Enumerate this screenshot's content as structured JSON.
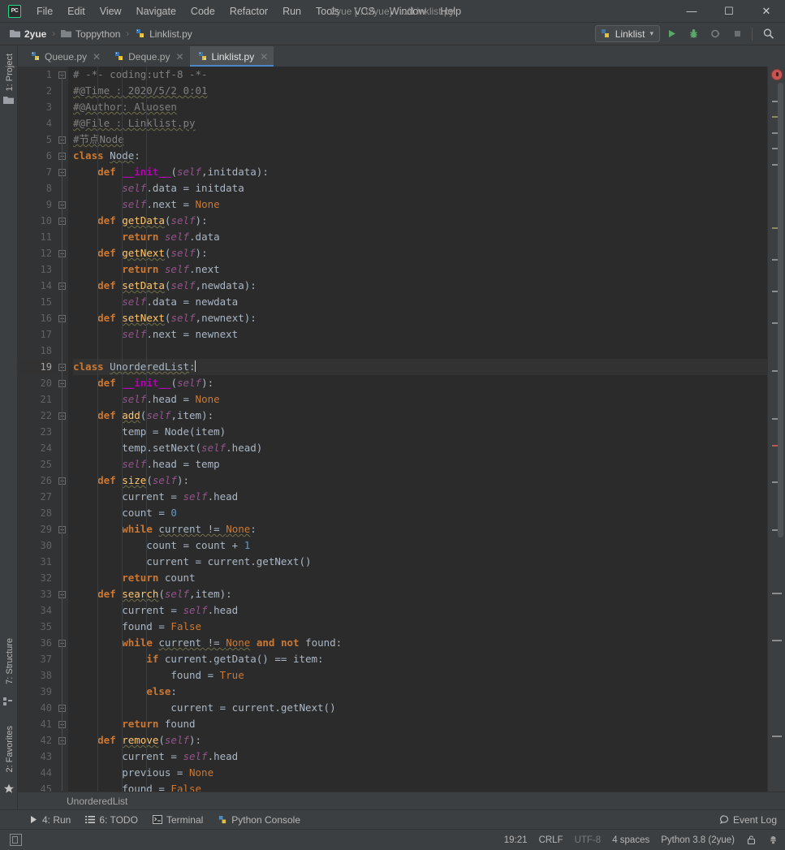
{
  "window": {
    "title": "2yue [...\\2yue] - ...\\Linklist.py",
    "logo_label": "PC",
    "controls": {
      "minimize": "—",
      "maximize": "☐",
      "close": "✕"
    }
  },
  "menu": {
    "items": [
      "File",
      "Edit",
      "View",
      "Navigate",
      "Code",
      "Refactor",
      "Run",
      "Tools",
      "VCS",
      "Window",
      "Help"
    ]
  },
  "breadcrumb": {
    "items": [
      {
        "label": "2yue",
        "icon": "folder-icon"
      },
      {
        "label": "Toppython",
        "icon": "folder-icon"
      },
      {
        "label": "Linklist.py",
        "icon": "python-file-icon"
      }
    ],
    "separator": "›"
  },
  "toolbar": {
    "run_config": "Linklist",
    "run_config_caret": "▾",
    "buttons": [
      {
        "name": "run-button",
        "icon": "play-icon"
      },
      {
        "name": "debug-button",
        "icon": "bug-icon"
      },
      {
        "name": "run-coverage-button",
        "icon": "coverage-icon"
      },
      {
        "name": "stop-button",
        "icon": "stop-icon"
      },
      {
        "name": "search-everywhere-button",
        "icon": "search-icon"
      }
    ]
  },
  "left_rail": {
    "project": "1: Project",
    "structure": "7: Structure",
    "favorites": "2: Favorites"
  },
  "editor_tabs": [
    {
      "label": "Queue.py",
      "icon": "python-file-icon",
      "active": false,
      "close": "✕"
    },
    {
      "label": "Deque.py",
      "icon": "python-file-icon",
      "active": false,
      "close": "✕"
    },
    {
      "label": "Linklist.py",
      "icon": "python-file-icon",
      "active": true,
      "close": "✕"
    }
  ],
  "editor": {
    "current_line": 19,
    "first_line": 1,
    "last_line": 45,
    "line_count": 45,
    "breadcrumb": "UnorderedList",
    "error_count_icon": "error-badge-icon",
    "lines": [
      {
        "n": 1,
        "fold": "minus",
        "html": "<span class=\"c-comment\">#</span> <span class=\"c-comment\">-*- coding:utf-8 -*-</span>"
      },
      {
        "n": 2,
        "fold": "",
        "html": "<span class=\"c-comment sq\">#@Time : 2020/5/2 0:01</span>"
      },
      {
        "n": 3,
        "fold": "",
        "html": "<span class=\"c-comment sq\">#@Author: Aluosen</span>"
      },
      {
        "n": 4,
        "fold": "",
        "html": "<span class=\"c-comment sq\">#@File : Linklist.py</span>"
      },
      {
        "n": 5,
        "fold": "minus",
        "html": "<span class=\"c-comment sq\">#节点Node</span>"
      },
      {
        "n": 6,
        "fold": "minus",
        "html": "<span class=\"c-kw\">class</span> <span class=\"c-cls sq\">Node</span>:"
      },
      {
        "n": 7,
        "fold": "minus",
        "html": "    <span class=\"c-def\">def</span> <span class=\"c-magic\">__init__</span>(<span class=\"c-self\">self</span>,initdata):"
      },
      {
        "n": 8,
        "fold": "",
        "html": "        <span class=\"c-self\">self</span>.data = initdata"
      },
      {
        "n": 9,
        "fold": "minus",
        "html": "        <span class=\"c-self\">self</span>.next = <span class=\"c-const\">None</span>"
      },
      {
        "n": 10,
        "fold": "minus",
        "html": "    <span class=\"c-def\">def</span> <span class=\"c-fn sq\">getData</span>(<span class=\"c-self\">self</span>):"
      },
      {
        "n": 11,
        "fold": "",
        "html": "        <span class=\"c-kw\">return</span> <span class=\"c-self\">self</span>.data"
      },
      {
        "n": 12,
        "fold": "minus",
        "html": "    <span class=\"c-def\">def</span> <span class=\"c-fn sq\">getNext</span>(<span class=\"c-self\">self</span>):"
      },
      {
        "n": 13,
        "fold": "",
        "html": "        <span class=\"c-kw\">return</span> <span class=\"c-self\">self</span>.next"
      },
      {
        "n": 14,
        "fold": "minus",
        "html": "    <span class=\"c-def\">def</span> <span class=\"c-fn sq\">setData</span>(<span class=\"c-self\">self</span>,newdata):"
      },
      {
        "n": 15,
        "fold": "",
        "html": "        <span class=\"c-self\">self</span>.data = newdata"
      },
      {
        "n": 16,
        "fold": "minus",
        "html": "    <span class=\"c-def\">def</span> <span class=\"c-fn sq\">setNext</span>(<span class=\"c-self\">self</span>,newnext):"
      },
      {
        "n": 17,
        "fold": "",
        "html": "        <span class=\"c-self\">self</span>.next = newnext"
      },
      {
        "n": 18,
        "fold": "",
        "html": ""
      },
      {
        "n": 19,
        "fold": "minus",
        "html": "<span class=\"c-kw\">class</span> <span class=\"c-cls sq\">UnorderedList</span>:<span class=\"caret\"></span>"
      },
      {
        "n": 20,
        "fold": "minus",
        "html": "    <span class=\"c-def\">def</span> <span class=\"c-magic\">__init__</span>(<span class=\"c-self\">self</span>):"
      },
      {
        "n": 21,
        "fold": "",
        "html": "        <span class=\"c-self\">self</span>.head = <span class=\"c-const\">None</span>"
      },
      {
        "n": 22,
        "fold": "minus",
        "html": "    <span class=\"c-def\">def</span> <span class=\"c-fn sq\">add</span>(<span class=\"c-self\">self</span>,item):"
      },
      {
        "n": 23,
        "fold": "",
        "html": "        temp = Node(item)"
      },
      {
        "n": 24,
        "fold": "",
        "html": "        temp.setNext(<span class=\"c-self\">self</span>.head)"
      },
      {
        "n": 25,
        "fold": "",
        "html": "        <span class=\"c-self\">self</span>.head = temp"
      },
      {
        "n": 26,
        "fold": "minus",
        "html": "    <span class=\"c-def\">def</span> <span class=\"c-fn sq\">size</span>(<span class=\"c-self\">self</span>):"
      },
      {
        "n": 27,
        "fold": "",
        "html": "        current = <span class=\"c-self\">self</span>.head"
      },
      {
        "n": 28,
        "fold": "",
        "html": "        count = <span class=\"c-num\">0</span>"
      },
      {
        "n": 29,
        "fold": "minus",
        "html": "        <span class=\"c-kw\">while</span> <span class=\"sq\">current != <span class=\"c-const\">None</span></span>:"
      },
      {
        "n": 30,
        "fold": "",
        "html": "            count = count + <span class=\"c-num\">1</span>"
      },
      {
        "n": 31,
        "fold": "",
        "html": "            current = current.getNext()"
      },
      {
        "n": 32,
        "fold": "",
        "html": "        <span class=\"c-kw\">return</span> count"
      },
      {
        "n": 33,
        "fold": "minus",
        "html": "    <span class=\"c-def\">def</span> <span class=\"c-fn sq\">search</span>(<span class=\"c-self\">self</span>,item):"
      },
      {
        "n": 34,
        "fold": "",
        "html": "        current = <span class=\"c-self\">self</span>.head"
      },
      {
        "n": 35,
        "fold": "",
        "html": "        found = <span class=\"c-const\">False</span>"
      },
      {
        "n": 36,
        "fold": "minus",
        "html": "        <span class=\"c-kw\">while</span> <span class=\"sq\">current != <span class=\"c-const\">None</span></span> <span class=\"c-kw\">and</span> <span class=\"c-kw\">not</span> found:"
      },
      {
        "n": 37,
        "fold": "",
        "html": "            <span class=\"c-kw\">if</span> current.getData() == item:"
      },
      {
        "n": 38,
        "fold": "",
        "html": "                found = <span class=\"c-const\">True</span>"
      },
      {
        "n": 39,
        "fold": "",
        "html": "            <span class=\"c-kw\">else</span>:"
      },
      {
        "n": 40,
        "fold": "minus",
        "html": "                current = current.getNext()"
      },
      {
        "n": 41,
        "fold": "minus",
        "html": "        <span class=\"c-kw\">return</span> found"
      },
      {
        "n": 42,
        "fold": "minus",
        "html": "    <span class=\"c-def\">def</span> <span class=\"c-fn sq\">remove</span>(<span class=\"c-self\">self</span>):"
      },
      {
        "n": 43,
        "fold": "",
        "html": "        current = <span class=\"c-self\">self</span>.head"
      },
      {
        "n": 44,
        "fold": "",
        "html": "        previous = <span class=\"c-const\">None</span>"
      },
      {
        "n": 45,
        "fold": "",
        "html": "        found = <span class=\"c-const\">False</span>"
      }
    ]
  },
  "tool_windows": [
    {
      "label": "4: Run",
      "mnemonic": "4",
      "icon": "play-icon"
    },
    {
      "label": "6: TODO",
      "mnemonic": "6",
      "icon": "todo-list-icon"
    },
    {
      "label": "Terminal",
      "mnemonic": "",
      "icon": "terminal-icon"
    },
    {
      "label": "Python Console",
      "mnemonic": "",
      "icon": "python-icon"
    }
  ],
  "event_log": {
    "label": "Event Log",
    "icon": "balloon-icon"
  },
  "statusbar": {
    "position": "19:21",
    "line_separator": "CRLF",
    "encoding": "UTF-8",
    "indent": "4 spaces",
    "interpreter": "Python 3.8 (2yue)",
    "lock_icon": "lock-icon",
    "inspection_icon": "inspection-hector-icon"
  },
  "colors": {
    "accent_blue": "#4a88c7",
    "run_green": "#499c54",
    "error_red": "#c75450",
    "editor_bg": "#2b2b2b",
    "chrome_bg": "#3c3f41",
    "gutter_bg": "#313335",
    "current_line_bg": "#323232",
    "keyword_orange": "#cc7832",
    "function_yellow": "#ffc66d",
    "self_purple": "#94558d",
    "number_blue": "#6897bb",
    "comment_grey": "#808080",
    "text_grey": "#a9b7c6"
  }
}
